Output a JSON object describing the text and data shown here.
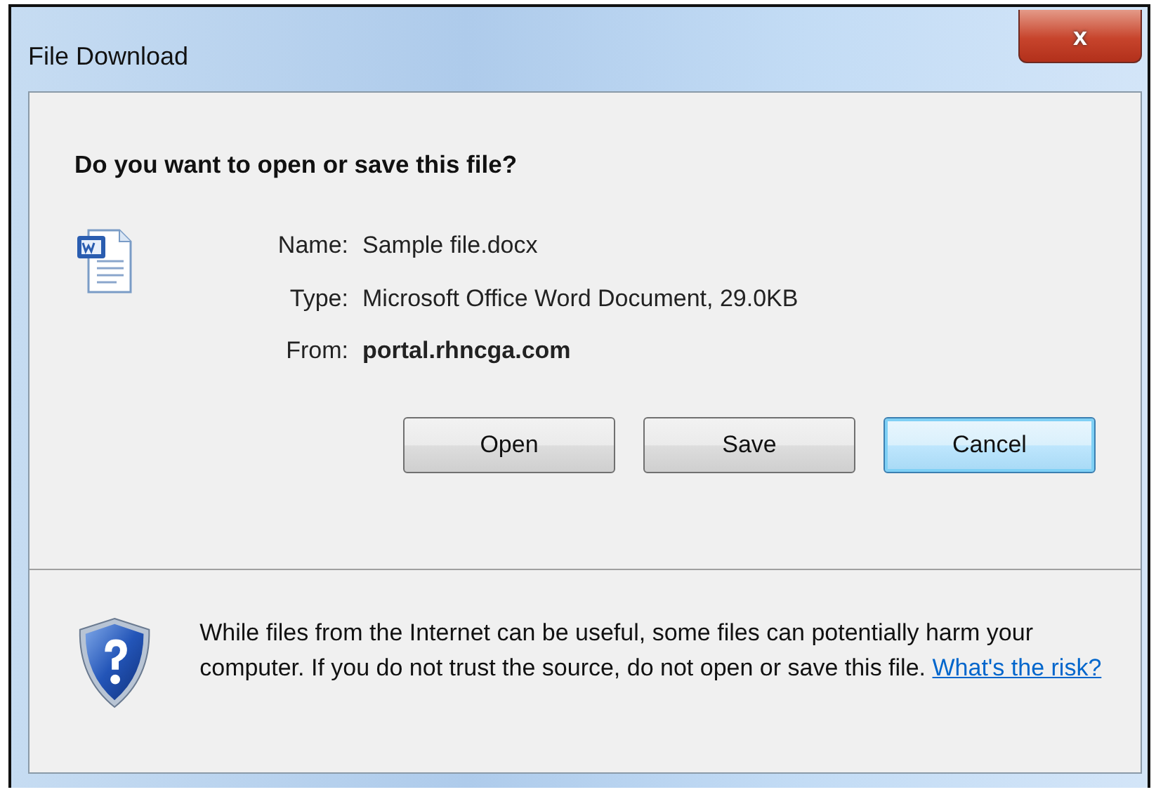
{
  "window": {
    "title": "File Download",
    "close": "x"
  },
  "heading": "Do you want to open or save this file?",
  "fields": [
    {
      "label": "Name:",
      "value": "Sample file.docx",
      "bold": false
    },
    {
      "label": "Type:",
      "value": "Microsoft Office Word Document, 29.0KB",
      "bold": false
    },
    {
      "label": "From:",
      "value": "portal.rhncga.com",
      "bold": true
    }
  ],
  "buttons": [
    {
      "label": "Open",
      "default": false
    },
    {
      "label": "Save",
      "default": false
    },
    {
      "label": "Cancel",
      "default": true
    }
  ],
  "warning": {
    "text": "While files from the Internet can be useful, some files can potentially harm your computer. If you do not trust the source, do not open or save this file.",
    "link": "What's the risk?"
  }
}
